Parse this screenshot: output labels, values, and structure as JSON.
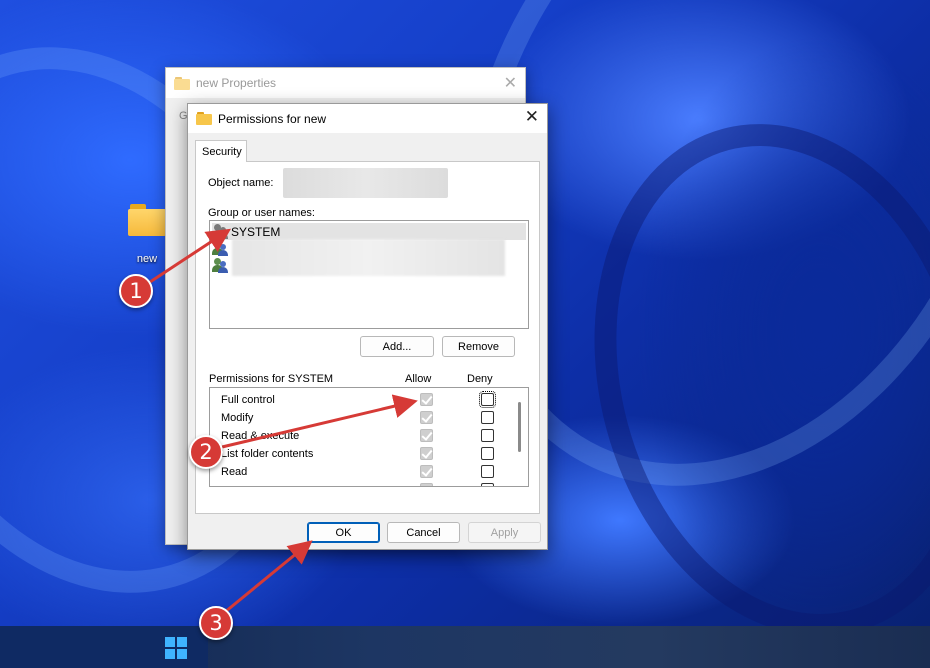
{
  "desktop": {
    "folder_label": "new"
  },
  "properties_window": {
    "title": "new Properties",
    "partial_tab_letter": "G"
  },
  "permissions_dialog": {
    "title": "Permissions for new",
    "tab_label": "Security",
    "object_name_label": "Object name:",
    "group_label": "Group or user names:",
    "users": [
      {
        "name": "SYSTEM",
        "selected": true
      }
    ],
    "add_button": "Add...",
    "remove_button": "Remove",
    "permissions_header": "Permissions for SYSTEM",
    "allow_header": "Allow",
    "deny_header": "Deny",
    "permissions": [
      {
        "name": "Full control",
        "allow": true,
        "deny": false
      },
      {
        "name": "Modify",
        "allow": true,
        "deny": false
      },
      {
        "name": "Read & execute",
        "allow": true,
        "deny": false
      },
      {
        "name": "List folder contents",
        "allow": true,
        "deny": false
      },
      {
        "name": "Read",
        "allow": true,
        "deny": false
      }
    ],
    "ok_button": "OK",
    "cancel_button": "Cancel",
    "apply_button": "Apply"
  },
  "annotations": {
    "step1": "1",
    "step2": "2",
    "step3": "3",
    "color": "#d63a36"
  },
  "close_glyph": "✕"
}
